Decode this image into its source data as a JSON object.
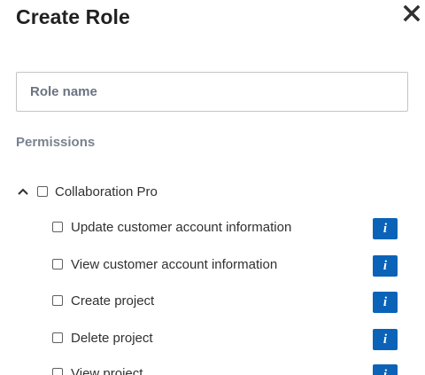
{
  "dialog": {
    "title": "Create Role",
    "close_icon": "close-icon"
  },
  "role_name": {
    "placeholder": "Role name",
    "value": ""
  },
  "permissions": {
    "label": "Permissions",
    "group": {
      "label": "Collaboration Pro",
      "expanded": true,
      "checked": false,
      "chevron_icon": "chevron-up-icon"
    },
    "items": [
      {
        "label": "Update customer account information",
        "checked": false,
        "info": "i"
      },
      {
        "label": "View customer account information",
        "checked": false,
        "info": "i"
      },
      {
        "label": "Create project",
        "checked": false,
        "info": "i"
      },
      {
        "label": "Delete project",
        "checked": false,
        "info": "i"
      },
      {
        "label": "View project",
        "checked": false,
        "info": "i"
      }
    ]
  },
  "colors": {
    "info_button": "#0b63b8",
    "placeholder": "#6b7380",
    "section_label": "#7a8290"
  }
}
